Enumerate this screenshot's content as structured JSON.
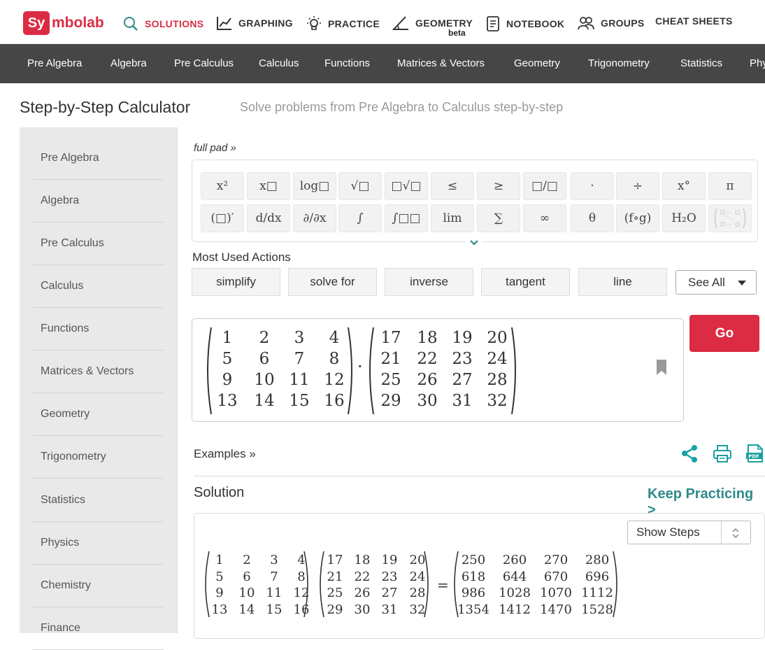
{
  "brand": {
    "logo_sy": "Sy",
    "logo_rest": "mbolab"
  },
  "top_nav": [
    {
      "label": "SOLUTIONS",
      "icon": "search-icon"
    },
    {
      "label": "GRAPHING",
      "icon": "graph-icon"
    },
    {
      "label": "PRACTICE",
      "icon": "lightbulb-icon"
    },
    {
      "label": "GEOMETRY",
      "icon": "angle-icon",
      "badge": "beta"
    },
    {
      "label": "NOTEBOOK",
      "icon": "notebook-icon"
    },
    {
      "label": "GROUPS",
      "icon": "groups-icon"
    },
    {
      "label": "CHEAT SHEETS"
    }
  ],
  "category_bar": [
    "Pre Algebra",
    "Algebra",
    "Pre Calculus",
    "Calculus",
    "Functions",
    "Matrices & Vectors",
    "Geometry",
    "Trigonometry",
    "Statistics",
    "Phy"
  ],
  "header": {
    "title": "Step-by-Step Calculator",
    "subtitle": "Solve problems from Pre Algebra to Calculus step-by-step"
  },
  "sidebar": [
    "Pre Algebra",
    "Algebra",
    "Pre Calculus",
    "Calculus",
    "Functions",
    "Matrices & Vectors",
    "Geometry",
    "Trigonometry",
    "Statistics",
    "Physics",
    "Chemistry",
    "Finance"
  ],
  "keypad": {
    "toggle_label": "full pad »",
    "row1": [
      "x²",
      "x□",
      "log□",
      "√□",
      "□√□",
      "≤",
      "≥",
      "□/□",
      "·",
      "÷",
      "x°",
      "π"
    ],
    "row2": [
      "(□)′",
      "d/dx",
      "∂/∂x",
      "∫",
      "∫□□",
      "lim",
      "∑",
      "∞",
      "θ",
      "(f∘g)",
      "H₂O",
      "matrix"
    ]
  },
  "most_used": {
    "label": "Most Used Actions",
    "actions": [
      "simplify",
      "solve for",
      "inverse",
      "tangent",
      "line"
    ],
    "see_all": "See All"
  },
  "input": {
    "matrix_a": [
      [
        "1",
        "2",
        "3",
        "4"
      ],
      [
        "5",
        "6",
        "7",
        "8"
      ],
      [
        "9",
        "10",
        "11",
        "12"
      ],
      [
        "13",
        "14",
        "15",
        "16"
      ]
    ],
    "operator": "·",
    "matrix_b": [
      [
        "17",
        "18",
        "19",
        "20"
      ],
      [
        "21",
        "22",
        "23",
        "24"
      ],
      [
        "25",
        "26",
        "27",
        "28"
      ],
      [
        "29",
        "30",
        "31",
        "32"
      ]
    ]
  },
  "go_label": "Go",
  "examples_label": "Examples »",
  "solution": {
    "title": "Solution",
    "keep_practicing": "Keep Practicing >",
    "show_steps": "Show Steps",
    "equals": "=",
    "result": [
      [
        "250",
        "260",
        "270",
        "280"
      ],
      [
        "618",
        "644",
        "670",
        "696"
      ],
      [
        "986",
        "1028",
        "1070",
        "1112"
      ],
      [
        "1354",
        "1412",
        "1470",
        "1528"
      ]
    ]
  },
  "colors": {
    "brand_red": "#db2c43",
    "teal": "#2e8b8b",
    "dark_bar": "#464646"
  }
}
